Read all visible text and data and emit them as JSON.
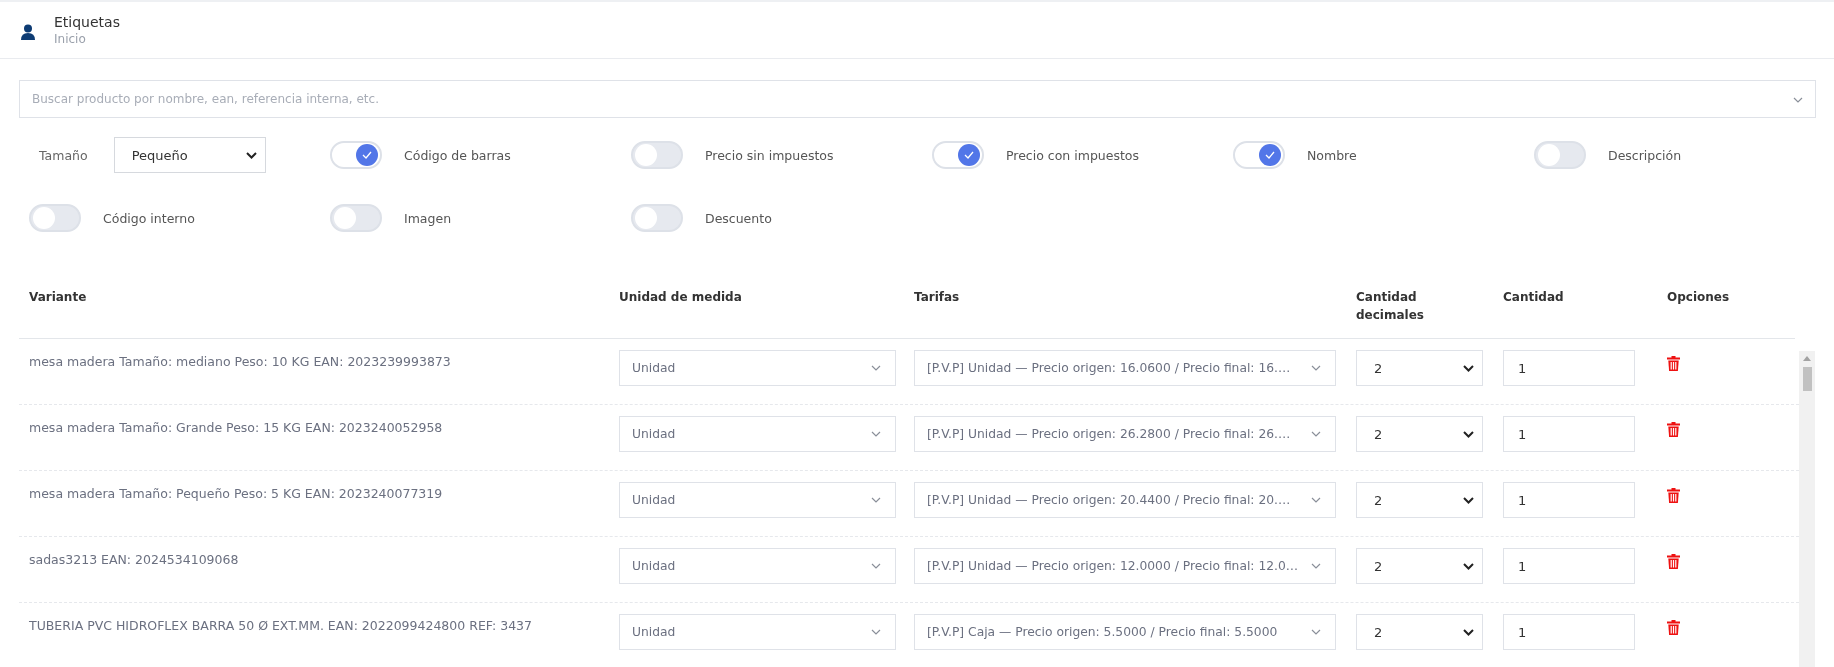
{
  "header": {
    "title": "Etiquetas",
    "subtitle": "Inicio"
  },
  "search": {
    "placeholder": "Buscar producto por nombre, ean, referencia interna, etc."
  },
  "size": {
    "label": "Tamaño",
    "value": "Pequeño"
  },
  "options": [
    {
      "label": "Código de barras",
      "on": true
    },
    {
      "label": "Precio sin impuestos",
      "on": false
    },
    {
      "label": "Precio con impuestos",
      "on": true
    },
    {
      "label": "Nombre",
      "on": true
    },
    {
      "label": "Descripción",
      "on": false
    },
    {
      "label": "Código interno",
      "on": false
    },
    {
      "label": "Imagen",
      "on": false
    },
    {
      "label": "Descuento",
      "on": false
    }
  ],
  "table": {
    "columns": [
      "Variante",
      "Unidad de medida",
      "Tarifas",
      "Cantidad decimales",
      "Cantidad",
      "Opciones"
    ],
    "rows": [
      {
        "variant": "mesa madera Tamaño: mediano Peso: 10 KG EAN: 2023239993873",
        "unit": "Unidad",
        "rate": "[P.V.P] Unidad — Precio origen: 16.0600 / Precio final: 16.…",
        "decimals": "2",
        "quantity": "1"
      },
      {
        "variant": "mesa madera Tamaño: Grande Peso: 15 KG EAN: 2023240052958",
        "unit": "Unidad",
        "rate": "[P.V.P] Unidad — Precio origen: 26.2800 / Precio final: 26.…",
        "decimals": "2",
        "quantity": "1"
      },
      {
        "variant": "mesa madera Tamaño: Pequeño Peso: 5 KG EAN: 2023240077319",
        "unit": "Unidad",
        "rate": "[P.V.P] Unidad — Precio origen: 20.4400 / Precio final: 20.…",
        "decimals": "2",
        "quantity": "1"
      },
      {
        "variant": "sadas3213 EAN: 2024534109068",
        "unit": "Unidad",
        "rate": "[P.V.P] Unidad — Precio origen: 12.0000 / Precio final: 12.0…",
        "decimals": "2",
        "quantity": "1"
      },
      {
        "variant": "TUBERIA PVC HIDROFLEX BARRA 50 Ø EXT.MM. EAN: 2022099424800 REF: 3437",
        "unit": "Unidad",
        "rate": "[P.V.P] Caja — Precio origen: 5.5000 / Precio final: 5.5000",
        "decimals": "2",
        "quantity": "1"
      }
    ]
  }
}
